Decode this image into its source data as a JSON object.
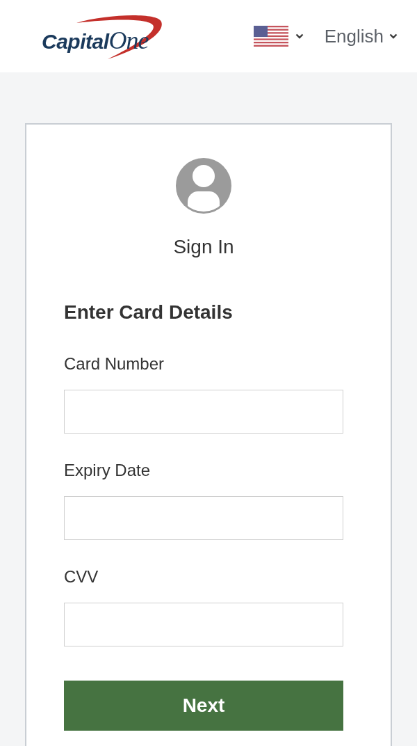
{
  "header": {
    "logo": {
      "text": "Capital",
      "suffix": "One"
    },
    "language_selector": {
      "label": "English"
    }
  },
  "card": {
    "title": "Sign In",
    "heading": "Enter Card Details",
    "fields": [
      {
        "label": "Card Number"
      },
      {
        "label": "Expiry Date"
      },
      {
        "label": "CVV"
      }
    ],
    "submit_button": {
      "label": "Next"
    }
  }
}
